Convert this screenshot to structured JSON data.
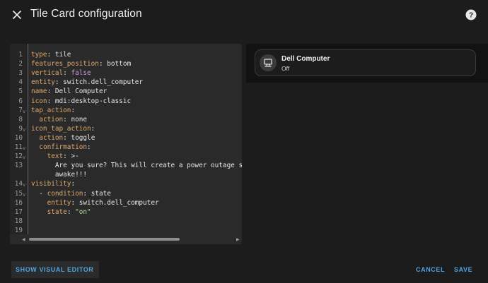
{
  "dialog": {
    "title": "Tile Card configuration",
    "close_icon": "close-icon",
    "help_icon": "help-circle-icon"
  },
  "editor": {
    "lines": [
      {
        "n": "1",
        "fold": "",
        "key": "type",
        "sep": ": ",
        "val": "tile",
        "vtype": "plain"
      },
      {
        "n": "2",
        "fold": "",
        "key": "features_position",
        "sep": ": ",
        "val": "bottom",
        "vtype": "plain"
      },
      {
        "n": "3",
        "fold": "",
        "key": "vertical",
        "sep": ": ",
        "val": "false",
        "vtype": "bool"
      },
      {
        "n": "4",
        "fold": "",
        "key": "entity",
        "sep": ": ",
        "val": "switch.dell_computer",
        "vtype": "plain"
      },
      {
        "n": "5",
        "fold": "",
        "key": "name",
        "sep": ": ",
        "val": "Dell Computer",
        "vtype": "plain"
      },
      {
        "n": "6",
        "fold": "",
        "key": "icon",
        "sep": ": ",
        "val": "mdi:desktop-classic",
        "vtype": "plain"
      },
      {
        "n": "7",
        "fold": "v",
        "key": "tap_action",
        "sep": ":",
        "val": "",
        "vtype": "plain"
      },
      {
        "n": "8",
        "fold": "",
        "indent": "  ",
        "key": "action",
        "sep": ": ",
        "val": "none",
        "vtype": "plain"
      },
      {
        "n": "9",
        "fold": "v",
        "key": "icon_tap_action",
        "sep": ":",
        "val": "",
        "vtype": "plain"
      },
      {
        "n": "10",
        "fold": "",
        "indent": "  ",
        "key": "action",
        "sep": ": ",
        "val": "toggle",
        "vtype": "plain"
      },
      {
        "n": "11",
        "fold": "v",
        "indent": "  ",
        "key": "confirmation",
        "sep": ":",
        "val": "",
        "vtype": "plain"
      },
      {
        "n": "12",
        "fold": "v",
        "indent": "    ",
        "key": "text",
        "sep": ": ",
        "val": ">-",
        "vtype": "plain"
      },
      {
        "n": "13",
        "fold": "",
        "indent": "      ",
        "key": "",
        "sep": "",
        "val": "Are you sure? This will create a power outage sce",
        "vtype": "plain"
      },
      {
        "n": "",
        "fold": "",
        "indent": "      ",
        "key": "",
        "sep": "",
        "val": "awake!!!",
        "vtype": "plain"
      },
      {
        "n": "14",
        "fold": "v",
        "key": "visibility",
        "sep": ":",
        "val": "",
        "vtype": "plain"
      },
      {
        "n": "15",
        "fold": "v",
        "indent": "  - ",
        "key": "condition",
        "sep": ": ",
        "val": "state",
        "vtype": "plain"
      },
      {
        "n": "16",
        "fold": "",
        "indent": "    ",
        "key": "entity",
        "sep": ": ",
        "val": "switch.dell_computer",
        "vtype": "plain"
      },
      {
        "n": "17",
        "fold": "",
        "indent": "    ",
        "key": "state",
        "sep": ": ",
        "val": "\"on\"",
        "vtype": "str"
      },
      {
        "n": "18",
        "fold": "",
        "key": "",
        "sep": "",
        "val": "",
        "vtype": "plain"
      },
      {
        "n": "19",
        "fold": "",
        "key": "",
        "sep": "",
        "val": "",
        "vtype": "plain"
      }
    ]
  },
  "preview": {
    "tile_name": "Dell Computer",
    "tile_state": "Off",
    "tile_icon": "desktop-classic-icon"
  },
  "footer": {
    "show_visual_editor": "SHOW VISUAL EDITOR",
    "cancel": "CANCEL",
    "save": "SAVE"
  }
}
